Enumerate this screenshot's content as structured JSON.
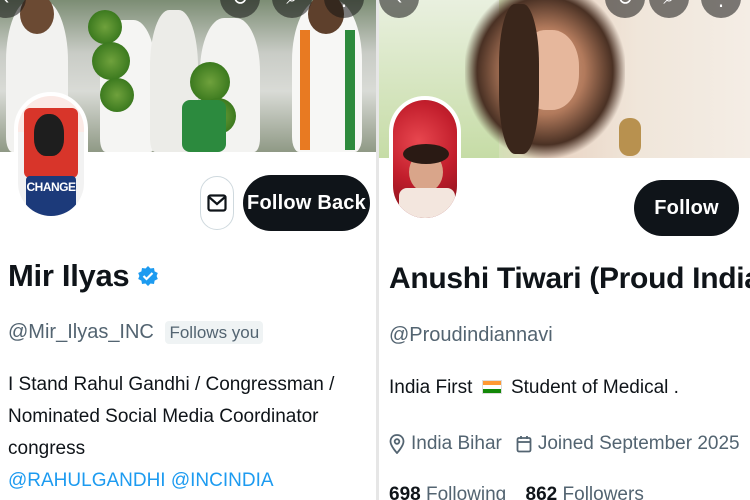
{
  "left_profile": {
    "avatar_text": "CHANGE",
    "follow_button": "Follow Back",
    "name": "Mir Ilyas",
    "handle": "@Mir_Ilyas_INC",
    "follows_you": "Follows you",
    "bio_lines": [
      "I Stand Rahul Gandhi / Congressman /",
      "Nominated Social Media Coordinator congress"
    ],
    "bio_mentions": "@RAHULGANDHI @INCINDIA",
    "verified_color": "#1d9bf0"
  },
  "right_profile": {
    "follow_button": "Follow",
    "name": "Anushi Tiwari (Proud Indian)",
    "handle": "@Proudindiannavi",
    "bio_prefix": "India First",
    "bio_flag": "🇮🇳",
    "bio_suffix": "Student of Medical .",
    "location": "India Bihar",
    "joined": "Joined September 2025",
    "following_count": "698",
    "following_label": "Following",
    "followers_count": "862",
    "followers_label": "Followers"
  },
  "icons": [
    "back-icon",
    "refresh-icon",
    "search-icon",
    "more-icon",
    "mail-icon",
    "verified-icon",
    "location-icon",
    "calendar-icon",
    "chevron-right-icon"
  ],
  "colors": {
    "accent": "#1d9bf0",
    "button_bg": "#0f1419",
    "secondary_text": "#536471"
  }
}
